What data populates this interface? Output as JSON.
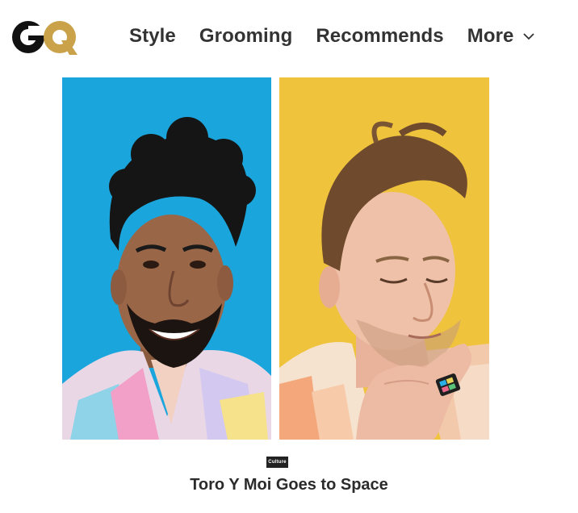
{
  "brand": {
    "logo_text": "GQ",
    "colors": {
      "g": "#111111",
      "q": "#c9a24a"
    }
  },
  "nav": {
    "items": [
      {
        "label": "Style"
      },
      {
        "label": "Grooming"
      },
      {
        "label": "Recommends"
      }
    ],
    "more_label": "More",
    "more_icon": "chevron-down-icon"
  },
  "hero": {
    "left_bg": "#1aa6dc",
    "right_bg": "#f0c33c"
  },
  "article": {
    "badge": "Culture",
    "title": "Toro Y Moi Goes to Space"
  }
}
